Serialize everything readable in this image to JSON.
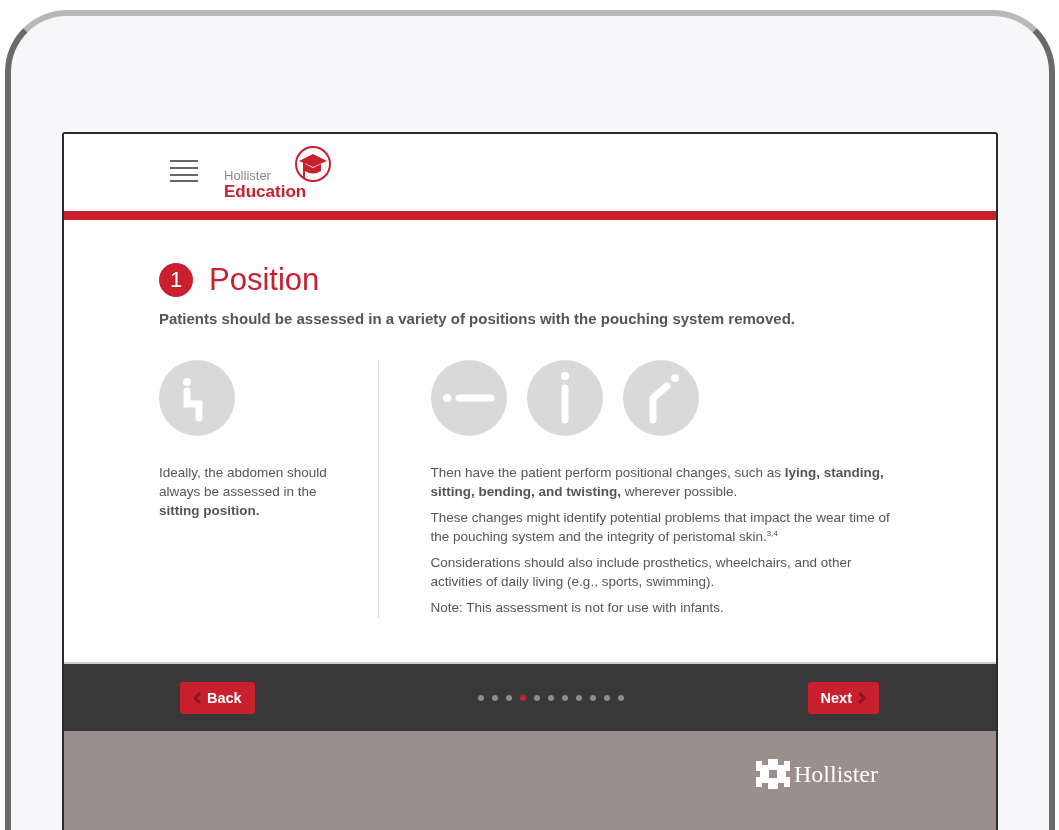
{
  "header": {
    "logo_top": "Hollister",
    "logo_bottom": "Education"
  },
  "section": {
    "number": "1",
    "title": "Position",
    "subtitle": "Patients should be assessed in a variety of positions with the pouching system removed."
  },
  "left": {
    "icons": [
      {
        "kind": "sitting"
      }
    ],
    "paragraphs": [
      "Ideally, the abdomen should always be assessed in the **sitting position.**"
    ]
  },
  "right": {
    "icons": [
      {
        "kind": "lying"
      },
      {
        "kind": "standing"
      },
      {
        "kind": "bending"
      }
    ],
    "paragraphs": [
      "Then have the patient perform positional changes, such as **lying, standing, sitting, bending, and twisting,** wherever possible.",
      "These changes might identify potential problems that impact the wear time of the pouching system and the integrity of peristomal skin.$^{3,4}$",
      "Considerations should also include prosthetics, wheelchairs, and other activities of daily living (e.g., sports, swimming).",
      "Note: This assessment is not for use with infants."
    ]
  },
  "nav": {
    "back": "Back",
    "next": "Next",
    "dots": [
      {
        "selected": false
      },
      {
        "selected": false
      },
      {
        "selected": false
      },
      {
        "selected": true
      },
      {
        "selected": false
      },
      {
        "selected": false
      },
      {
        "selected": false
      },
      {
        "selected": false
      },
      {
        "selected": false
      },
      {
        "selected": false
      },
      {
        "selected": false
      }
    ]
  },
  "footer": {
    "brand": "Hollister"
  }
}
